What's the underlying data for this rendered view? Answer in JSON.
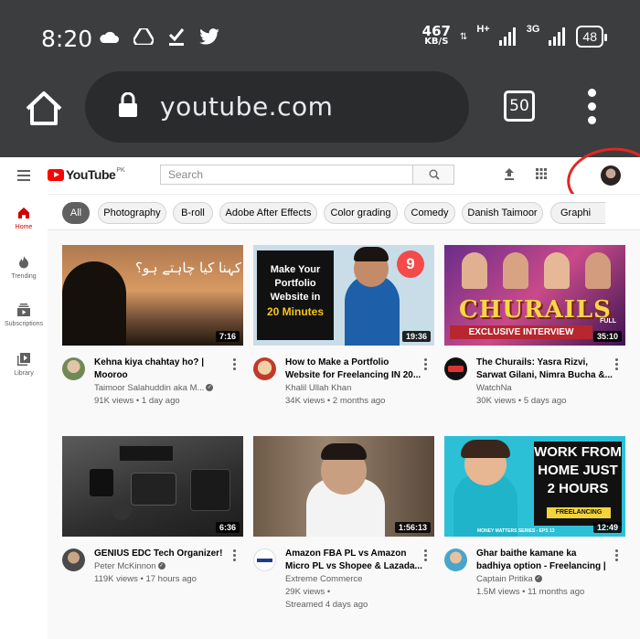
{
  "status": {
    "time": "8:20",
    "speed_value": "467",
    "speed_unit": "KB/S",
    "net1": "H+",
    "net2": "3G",
    "battery": "48"
  },
  "browser": {
    "url": "youtube.com",
    "tab_count": "50"
  },
  "youtube": {
    "logo_text": "YouTube",
    "logo_region": "PK",
    "search_placeholder": "Search",
    "sidebar": [
      {
        "label": "Home"
      },
      {
        "label": "Trending"
      },
      {
        "label": "Subscriptions"
      },
      {
        "label": "Library"
      }
    ],
    "chips": [
      "All",
      "Photography",
      "B-roll",
      "Adobe After Effects",
      "Color grading",
      "Comedy",
      "Danish Taimoor",
      "Graphi"
    ],
    "videos": [
      {
        "title": "Kehna kiya chahtay ho? | Mooroo",
        "channel": "Taimoor Salahuddin aka M...",
        "verified": true,
        "line3": "91K views • 1 day ago",
        "line4": "",
        "duration": "7:16",
        "overlay": "کہنا کیا چاہتے ہو؟"
      },
      {
        "title": "How to Make a Portfolio Website for Freelancing IN 20...",
        "channel": "Khalil Ullah Khan",
        "verified": false,
        "line3": "34K views • 2 months ago",
        "line4": "",
        "duration": "19:36",
        "overlay": "Make Your Portfolio Website in",
        "overlay2": "20 Minutes",
        "badge": "9"
      },
      {
        "title": "The Churails: Yasra Rizvi, Sarwat Gilani, Nimra Bucha &...",
        "channel": "WatchNa",
        "verified": false,
        "line3": "30K views • 5 days ago",
        "line4": "",
        "duration": "35:10",
        "overlay": "CHURAILS",
        "overlay2": "EXCLUSIVE INTERVIEW",
        "overlay3": "FULL"
      },
      {
        "title": "GENIUS EDC Tech Organizer!",
        "channel": "Peter McKinnon",
        "verified": true,
        "line3": "119K views • 17 hours ago",
        "line4": "",
        "duration": "6:36"
      },
      {
        "title": "Amazon FBA PL vs Amazon Micro PL vs Shopee & Lazada...",
        "channel": "Extreme Commerce",
        "verified": false,
        "line3": "29K views •",
        "line4": "Streamed 4 days ago",
        "duration": "1:56:13"
      },
      {
        "title": "Ghar baithe kamane ka badhiya option - Freelancing | Work fro...",
        "channel": "Captain Pritika",
        "verified": true,
        "line3": "1.5M views • 11 months ago",
        "line4": "",
        "duration": "12:49",
        "overlay": "WORK FROM HOME JUST 2 HOURS",
        "overlay2": "FREELANCING",
        "overlay3": "MONEY MATTERS SERIES - EPS 13"
      }
    ]
  },
  "colors": {
    "chrome_bg": "#3c3d3f",
    "yt_red": "#ff0000",
    "annotation": "#e32525"
  }
}
